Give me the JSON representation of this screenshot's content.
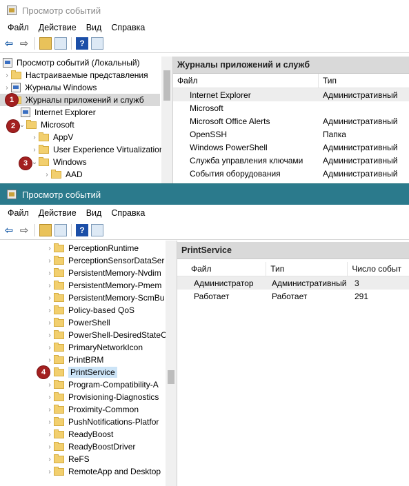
{
  "top": {
    "title": "Просмотр событий",
    "menu": [
      "Файл",
      "Действие",
      "Вид",
      "Справка"
    ],
    "tree": {
      "root": "Просмотр событий (Локальный)",
      "items": [
        "Настраиваемые представления",
        "Журналы Windows",
        "Журналы приложений и служб",
        "Internet Explorer",
        "Microsoft",
        "AppV",
        "User Experience Virtualization",
        "Windows",
        "AAD"
      ]
    },
    "right": {
      "header": "Журналы приложений и служб",
      "columns": [
        "Файл",
        "Тип"
      ],
      "rows": [
        {
          "name": "Internet Explorer",
          "type": "Административный"
        },
        {
          "name": "Microsoft",
          "type": ""
        },
        {
          "name": "Microsoft Office Alerts",
          "type": "Административный"
        },
        {
          "name": "OpenSSH",
          "type": "Папка"
        },
        {
          "name": "Windows PowerShell",
          "type": "Административный"
        },
        {
          "name": "Служба управления ключами",
          "type": "Административный"
        },
        {
          "name": "События оборудования",
          "type": "Административный"
        }
      ]
    }
  },
  "bottom": {
    "title": "Просмотр событий",
    "menu": [
      "Файл",
      "Действие",
      "Вид",
      "Справка"
    ],
    "tree": [
      "PerceptionRuntime",
      "PerceptionSensorDataSer",
      "PersistentMemory-Nvdim",
      "PersistentMemory-Pmem",
      "PersistentMemory-ScmBu",
      "Policy-based QoS",
      "PowerShell",
      "PowerShell-DesiredStateC",
      "PrimaryNetworkIcon",
      "PrintBRM",
      "PrintService",
      "Program-Compatibility-A",
      "Provisioning-Diagnostics",
      "Proximity-Common",
      "PushNotifications-Platfor",
      "ReadyBoost",
      "ReadyBoostDriver",
      "ReFS",
      "RemoteApp and Desktop"
    ],
    "right": {
      "header": "PrintService",
      "columns": [
        "Файл",
        "Тип",
        "Число событ"
      ],
      "rows": [
        {
          "name": "Администратор",
          "type": "Административный",
          "count": "3"
        },
        {
          "name": "Работает",
          "type": "Работает",
          "count": "291"
        }
      ]
    }
  },
  "badges": [
    "1",
    "2",
    "3",
    "4"
  ]
}
